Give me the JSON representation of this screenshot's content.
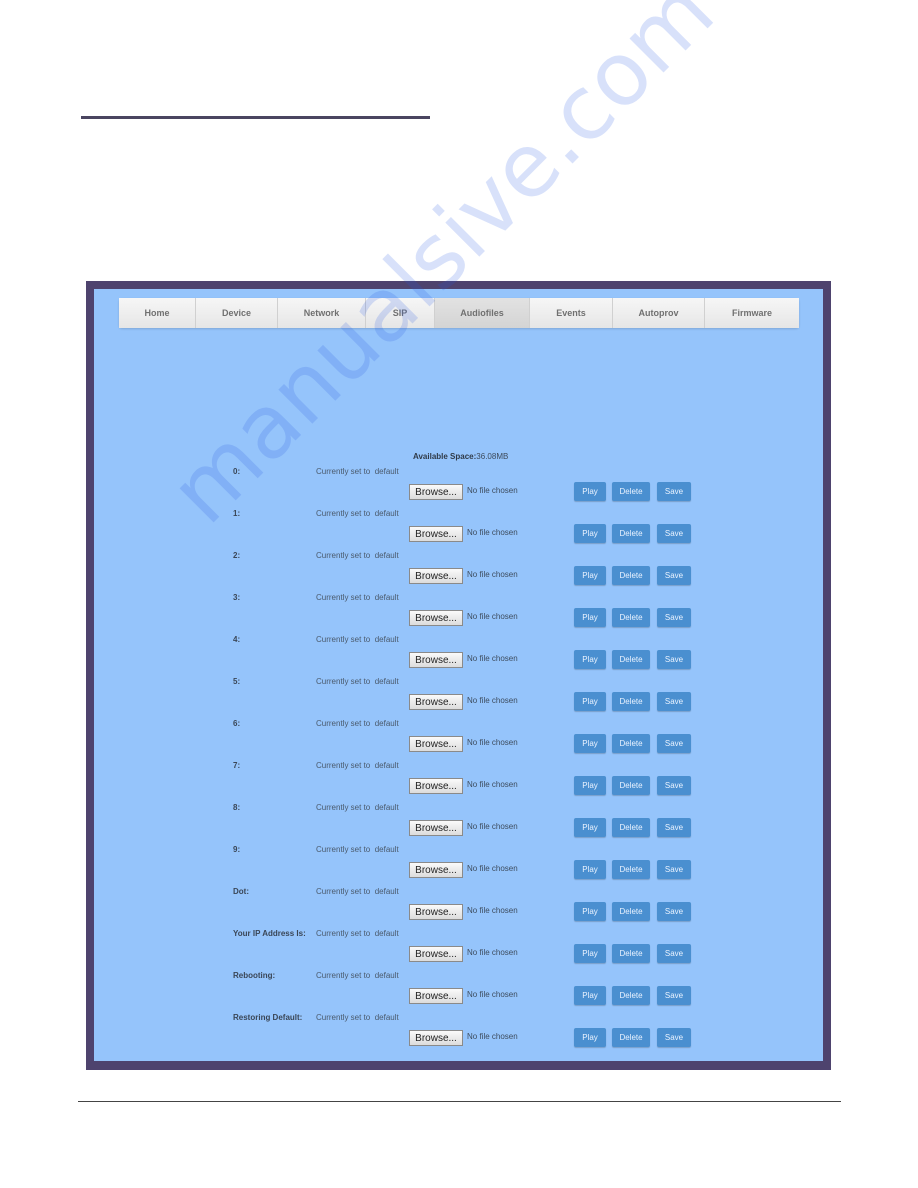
{
  "nav": {
    "tabs": [
      {
        "label": "Home",
        "active": false
      },
      {
        "label": "Device",
        "active": false
      },
      {
        "label": "Network",
        "active": false
      },
      {
        "label": "SIP",
        "active": false
      },
      {
        "label": "Audiofiles",
        "active": true
      },
      {
        "label": "Events",
        "active": false
      },
      {
        "label": "Autoprov",
        "active": false
      },
      {
        "label": "Firmware",
        "active": false
      }
    ]
  },
  "available_space": {
    "label": "Available Space:",
    "value": "36.08MB"
  },
  "common": {
    "currently_set_to": "Currently set to",
    "browse_label": "Browse...",
    "no_file": "No file chosen",
    "play": "Play",
    "delete": "Delete",
    "save": "Save"
  },
  "audiofiles": [
    {
      "label": "0:",
      "value": "default"
    },
    {
      "label": "1:",
      "value": "default"
    },
    {
      "label": "2:",
      "value": "default"
    },
    {
      "label": "3:",
      "value": "default"
    },
    {
      "label": "4:",
      "value": "default"
    },
    {
      "label": "5:",
      "value": "default"
    },
    {
      "label": "6:",
      "value": "default"
    },
    {
      "label": "7:",
      "value": "default"
    },
    {
      "label": "8:",
      "value": "default"
    },
    {
      "label": "9:",
      "value": "default"
    },
    {
      "label": "Dot:",
      "value": "default"
    },
    {
      "label": "Your IP Address Is:",
      "value": "default"
    },
    {
      "label": "Rebooting:",
      "value": "default"
    },
    {
      "label": "Restoring Default:",
      "value": "default"
    }
  ],
  "watermark": "manualsive.com"
}
